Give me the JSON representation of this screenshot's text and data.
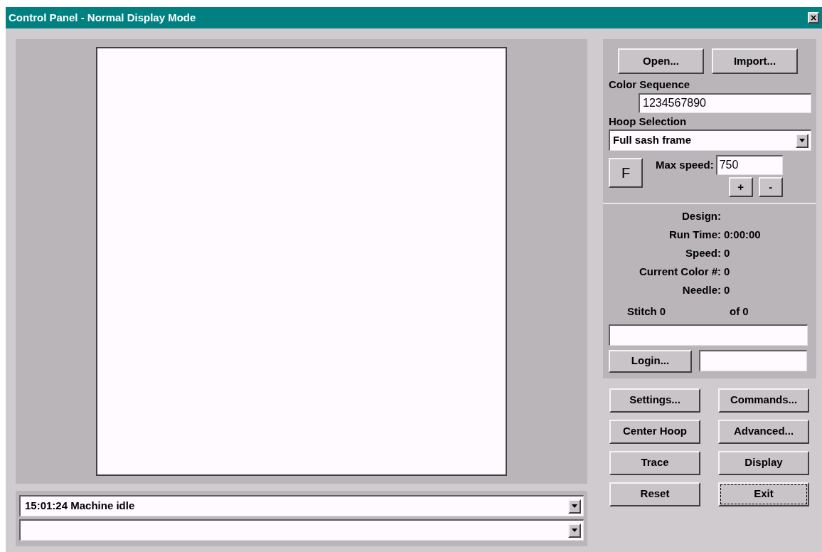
{
  "window": {
    "title": "Control Panel - Normal Display Mode",
    "close": "×"
  },
  "file_buttons": [
    "Open...",
    "Import..."
  ],
  "color_sequence": {
    "label": "Color Sequence",
    "value": "1234567890"
  },
  "hoop_selection": {
    "label": "Hoop Selection",
    "value": "Full sash frame"
  },
  "frame_button": "F",
  "max_speed": {
    "label": "Max speed:",
    "value": "750",
    "increase": "+",
    "decrease": "-"
  },
  "status": [
    {
      "label": "Design:"
    },
    {
      "label": "Run Time:",
      "value": "0:00:00"
    },
    {
      "label": "Speed:",
      "value": "0"
    },
    {
      "label": "Current Color #:",
      "value": "0"
    },
    {
      "label": "Needle:",
      "value": "0"
    }
  ],
  "stitch": {
    "label": "Stitch 0",
    "total": "of 0"
  },
  "login": {
    "button": "Login..."
  },
  "commands": [
    {
      "label": "Settings...",
      "focused": false
    },
    {
      "label": "Commands...",
      "focused": false
    },
    {
      "label": "Center Hoop",
      "focused": false
    },
    {
      "label": "Advanced...",
      "focused": false
    },
    {
      "label": "Trace",
      "focused": false
    },
    {
      "label": "Display",
      "focused": false
    },
    {
      "label": "Reset",
      "focused": false
    },
    {
      "label": "Exit",
      "focused": true
    }
  ],
  "message_log": [
    "15:01:24 Machine idle"
  ]
}
